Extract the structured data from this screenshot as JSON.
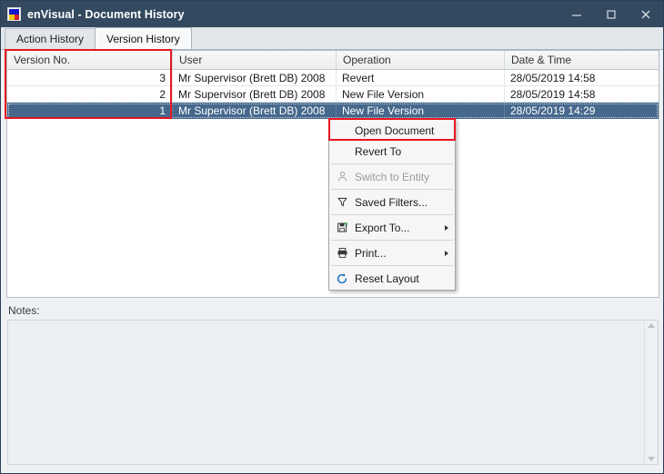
{
  "window": {
    "title": "enVisual - Document History",
    "icon": "envisual-app-icon",
    "minimize_label": "–",
    "maximize_label": "□",
    "close_label": "✕"
  },
  "tabs": [
    {
      "label": "Action History",
      "active": false
    },
    {
      "label": "Version History",
      "active": true
    }
  ],
  "grid": {
    "columns": [
      "Version No.",
      "User",
      "Operation",
      "Date & Time"
    ],
    "rows": [
      {
        "version": "3",
        "user": "Mr Supervisor (Brett DB) 2008",
        "operation": "Revert",
        "datetime": "28/05/2019 14:58",
        "selected": false
      },
      {
        "version": "2",
        "user": "Mr Supervisor (Brett DB) 2008",
        "operation": "New File Version",
        "datetime": "28/05/2019 14:58",
        "selected": false
      },
      {
        "version": "1",
        "user": "Mr Supervisor (Brett DB) 2008",
        "operation": "New File Version",
        "datetime": "28/05/2019 14:29",
        "selected": true
      }
    ]
  },
  "context_menu": {
    "items": [
      {
        "label": "Open Document",
        "icon": null,
        "disabled": false,
        "submenu": false
      },
      {
        "label": "Revert To",
        "icon": null,
        "disabled": false,
        "submenu": false
      },
      {
        "label": "Switch to Entity",
        "icon": "person-icon",
        "disabled": true,
        "submenu": false
      },
      {
        "label": "Saved Filters...",
        "icon": "funnel-icon",
        "disabled": false,
        "submenu": false
      },
      {
        "label": "Export To...",
        "icon": "save-disk-icon",
        "disabled": false,
        "submenu": true
      },
      {
        "label": "Print...",
        "icon": "printer-icon",
        "disabled": false,
        "submenu": true
      },
      {
        "label": "Reset Layout",
        "icon": "refresh-icon",
        "disabled": false,
        "submenu": false
      }
    ]
  },
  "notes": {
    "label": "Notes:",
    "value": "",
    "placeholder": ""
  },
  "colors": {
    "titlebar": "#33495f",
    "selection": "#46688c",
    "annotation": "#e8161f",
    "header": "#f1f2f3"
  }
}
